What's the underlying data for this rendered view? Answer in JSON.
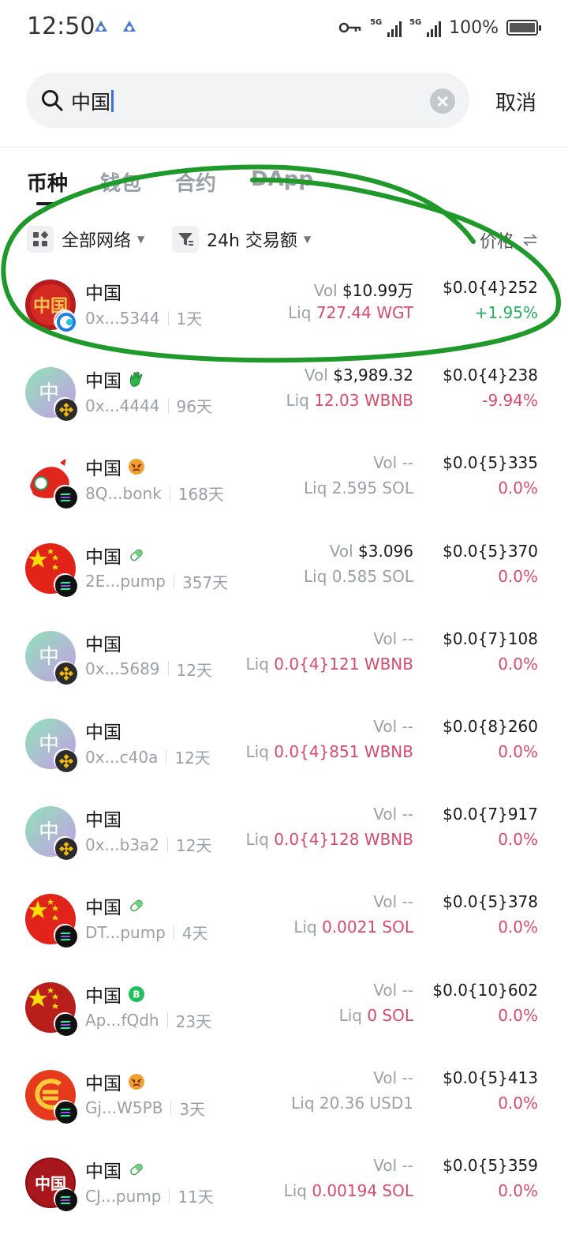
{
  "status_bar": {
    "time": "12:50",
    "signal1_label": "5G",
    "signal2_label": "5G",
    "battery": "100%"
  },
  "search": {
    "value": "中国",
    "cancel_label": "取消"
  },
  "tabs": [
    {
      "label": "币种",
      "active": true
    },
    {
      "label": "钱包",
      "active": false
    },
    {
      "label": "合约",
      "active": false
    },
    {
      "label": "DApp",
      "active": false
    }
  ],
  "filters": {
    "network_label": "全部网络",
    "sort_label": "24h 交易额",
    "price_label": "价格"
  },
  "labels": {
    "vol": "Vol",
    "liq": "Liq"
  },
  "colors": {
    "accent_green": "#22b05c",
    "accent_red": "#d94a6a",
    "muted": "#9aa0a8",
    "annotation": "#1f9a2a"
  },
  "tokens": [
    {
      "name": "中国",
      "badge": "",
      "address": "0x...5344",
      "age": "1天",
      "vol": "$10.99万",
      "liq": "727.44 WGT",
      "liq_highlight": true,
      "price": "$0.0{4}252",
      "change": "+1.95%",
      "trend": "up",
      "avatar": "red-seal",
      "chain": "wgt-chain-icon"
    },
    {
      "name": "中国",
      "badge": "hand-emoji-icon",
      "address": "0x...4444",
      "age": "96天",
      "vol": "$3,989.32",
      "liq": "12.03 WBNB",
      "liq_highlight": true,
      "price": "$0.0{4}238",
      "change": "-9.94%",
      "trend": "down",
      "avatar": "gradient-zhong",
      "chain": "bnb-chain-icon"
    },
    {
      "name": "中国",
      "badge": "angry-face-icon",
      "address": "8Q...bonk",
      "age": "168天",
      "vol": "--",
      "liq": "2.595 SOL",
      "liq_highlight": false,
      "price": "$0.0{5}335",
      "change": "0.0%",
      "trend": "flat",
      "avatar": "red-dragon",
      "chain": "solana-chain-icon"
    },
    {
      "name": "中国",
      "badge": "pill-icon",
      "address": "2E...pump",
      "age": "357天",
      "vol": "$3.096",
      "liq": "0.585 SOL",
      "liq_highlight": false,
      "price": "$0.0{5}370",
      "change": "0.0%",
      "trend": "flat",
      "avatar": "china-flag",
      "chain": "solana-chain-icon"
    },
    {
      "name": "中国",
      "badge": "",
      "address": "0x...5689",
      "age": "12天",
      "vol": "--",
      "liq": "0.0{4}121 WBNB",
      "liq_highlight": true,
      "price": "$0.0{7}108",
      "change": "0.0%",
      "trend": "flat",
      "avatar": "gradient-zhong",
      "chain": "bnb-chain-icon"
    },
    {
      "name": "中国",
      "badge": "",
      "address": "0x...c40a",
      "age": "12天",
      "vol": "--",
      "liq": "0.0{4}851 WBNB",
      "liq_highlight": true,
      "price": "$0.0{8}260",
      "change": "0.0%",
      "trend": "flat",
      "avatar": "gradient-zhong",
      "chain": "bnb-chain-icon"
    },
    {
      "name": "中国",
      "badge": "",
      "address": "0x...b3a2",
      "age": "12天",
      "vol": "--",
      "liq": "0.0{4}128 WBNB",
      "liq_highlight": true,
      "price": "$0.0{7}917",
      "change": "0.0%",
      "trend": "flat",
      "avatar": "gradient-zhong",
      "chain": "bnb-chain-icon"
    },
    {
      "name": "中国",
      "badge": "pill-icon",
      "address": "DT...pump",
      "age": "4天",
      "vol": "--",
      "liq": "0.0021 SOL",
      "liq_highlight": true,
      "price": "$0.0{5}378",
      "change": "0.0%",
      "trend": "flat",
      "avatar": "china-flag",
      "chain": "solana-chain-icon"
    },
    {
      "name": "中国",
      "badge": "green-circle-icon",
      "address": "Ap...fQdh",
      "age": "23天",
      "vol": "--",
      "liq": "0 SOL",
      "liq_highlight": true,
      "price": "$0.0{10}602",
      "change": "0.0%",
      "trend": "flat",
      "avatar": "china-flag-dark",
      "chain": "solana-chain-icon"
    },
    {
      "name": "中国",
      "badge": "angry-face-icon",
      "address": "Gj...W5PB",
      "age": "3天",
      "vol": "--",
      "liq": "20.36 USD1",
      "liq_highlight": false,
      "price": "$0.0{5}413",
      "change": "0.0%",
      "trend": "flat",
      "avatar": "red-coin",
      "chain": "solana-chain-icon"
    },
    {
      "name": "中国",
      "badge": "pill-icon",
      "address": "CJ...pump",
      "age": "11天",
      "vol": "--",
      "liq": "0.00194 SOL",
      "liq_highlight": true,
      "price": "$0.0{5}359",
      "change": "0.0%",
      "trend": "flat",
      "avatar": "dark-red-zhongguo",
      "chain": "solana-chain-icon"
    }
  ]
}
